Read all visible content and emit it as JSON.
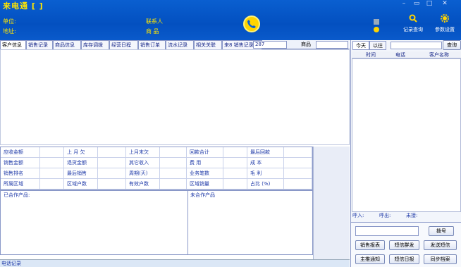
{
  "app": {
    "title": "来电通 [  ]",
    "win_buttons": [
      "–",
      "▭",
      "□",
      "✕"
    ]
  },
  "header": {
    "unit_label": "单位:",
    "address_label": "地址:",
    "contact_label": "联系人",
    "goods_label": "商    品",
    "tools": [
      {
        "label": "记录查询",
        "icon": "search-icon"
      },
      {
        "label": "参数设置",
        "icon": "gear-icon"
      }
    ]
  },
  "tabs": [
    "客户信息",
    "销售记录",
    "商品信息",
    "库存调拨",
    "经营日程",
    "销售订单",
    "流水记录",
    "相关关联",
    "来8 销售记录(天)"
  ],
  "tab_count": "287",
  "goods_field_label": "商品",
  "stats": [
    [
      "应收金额",
      "",
      "上 月 欠",
      "",
      "上月末欠",
      "",
      "回款合计",
      "",
      "最后回款",
      ""
    ],
    [
      "销售金额",
      "",
      "退货金额",
      "",
      "其它收入",
      "",
      "费      用",
      "",
      "成      本",
      ""
    ],
    [
      "销售排名",
      "",
      "最后销售",
      "",
      "周期(天)",
      "",
      "业务笔数",
      "",
      "毛      利",
      ""
    ],
    [
      "所属区域",
      "",
      "区域户数",
      "",
      "有效户数",
      "",
      "区域销量",
      "",
      "占比 (%)",
      ""
    ]
  ],
  "lists": {
    "left_title": "已合作产品:",
    "right_title": "未合作产品"
  },
  "statusbar": "电话记录",
  "right": {
    "tabs": [
      "今天",
      "以往"
    ],
    "query_button": "查询",
    "columns": [
      "时间",
      "电话",
      "客户名称"
    ],
    "status": {
      "ring": "呼入:",
      "callout": "呼出:",
      "unanswered": "未接:"
    },
    "dial_button": "拨号",
    "buttons": [
      [
        "销售报表",
        "短信群发",
        "发送短信"
      ],
      [
        "主推通知",
        "短信日报",
        "同步档案"
      ]
    ]
  }
}
